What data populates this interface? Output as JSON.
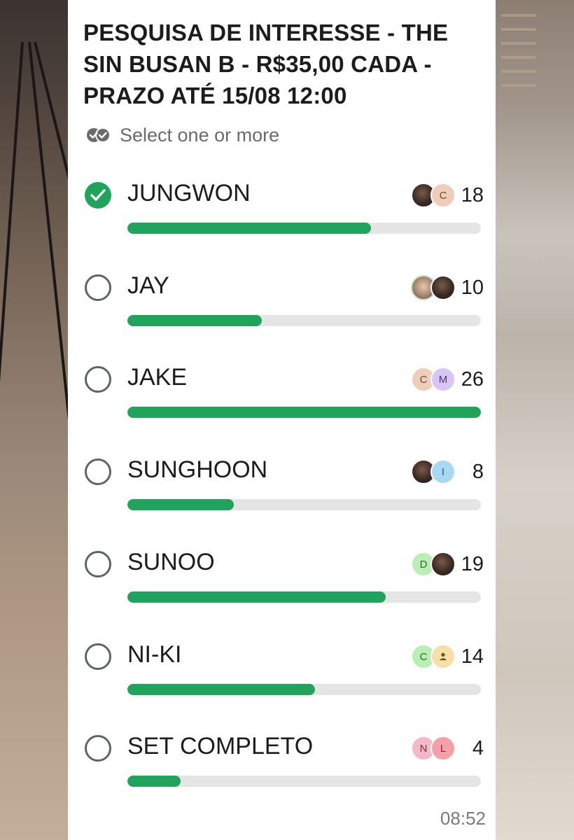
{
  "poll": {
    "title": "PESQUISA DE INTERESSE - THE SIN BUSAN B - R$35,00 CADA - PRAZO ATÉ 15/08 12:00",
    "select_hint": "Select one or more",
    "options": [
      {
        "label": "JUNGWON",
        "votes": "18",
        "fill_fraction": 0.69,
        "checked": true,
        "avatars": [
          {
            "kind": "photo-dark",
            "text": ""
          },
          {
            "kind": "letter",
            "text": "C",
            "bg": "#f0cdb8",
            "fg": "#6a4a3a"
          }
        ]
      },
      {
        "label": "JAY",
        "votes": "10",
        "fill_fraction": 0.38,
        "checked": false,
        "avatars": [
          {
            "kind": "photo-light",
            "text": ""
          },
          {
            "kind": "photo-dark",
            "text": ""
          }
        ]
      },
      {
        "label": "JAKE",
        "votes": "26",
        "fill_fraction": 1.0,
        "checked": false,
        "avatars": [
          {
            "kind": "letter",
            "text": "C",
            "bg": "#f0cdb8",
            "fg": "#6a4a3a"
          },
          {
            "kind": "letter",
            "text": "M",
            "bg": "#d9c6f5",
            "fg": "#4a3a6a"
          }
        ]
      },
      {
        "label": "SUNGHOON",
        "votes": "8",
        "fill_fraction": 0.3,
        "checked": false,
        "avatars": [
          {
            "kind": "photo-dark",
            "text": ""
          },
          {
            "kind": "letter",
            "text": "I",
            "bg": "#a9d8f3",
            "fg": "#2c5e7a"
          }
        ]
      },
      {
        "label": "SUNOO",
        "votes": "19",
        "fill_fraction": 0.73,
        "checked": false,
        "avatars": [
          {
            "kind": "letter",
            "text": "D",
            "bg": "#b9efb5",
            "fg": "#2f6a30"
          },
          {
            "kind": "photo-dark",
            "text": ""
          }
        ]
      },
      {
        "label": "NI-KI",
        "votes": "14",
        "fill_fraction": 0.53,
        "checked": false,
        "avatars": [
          {
            "kind": "letter",
            "text": "C",
            "bg": "#b9efb5",
            "fg": "#2f6a30"
          },
          {
            "kind": "person",
            "text": "",
            "bg": "#f7dfa8",
            "fg": "#6a5420"
          }
        ]
      },
      {
        "label": "SET COMPLETO",
        "votes": "4",
        "fill_fraction": 0.15,
        "checked": false,
        "avatars": [
          {
            "kind": "letter",
            "text": "N",
            "bg": "#f6b8c6",
            "fg": "#7a3040"
          },
          {
            "kind": "letter",
            "text": "L",
            "bg": "#f5a0a8",
            "fg": "#7a2a30"
          }
        ]
      }
    ],
    "timestamp": "08:52"
  },
  "colors": {
    "accent_green": "#20a35a",
    "bar_track": "#e5e5e5",
    "card_bg": "#ffffff",
    "text_primary": "#1c1c1c",
    "text_secondary": "#6b6b6b"
  },
  "icons": {
    "select_hint": "double-check-icon",
    "checked": "check-circle-icon",
    "unchecked": "radio-circle-icon"
  }
}
